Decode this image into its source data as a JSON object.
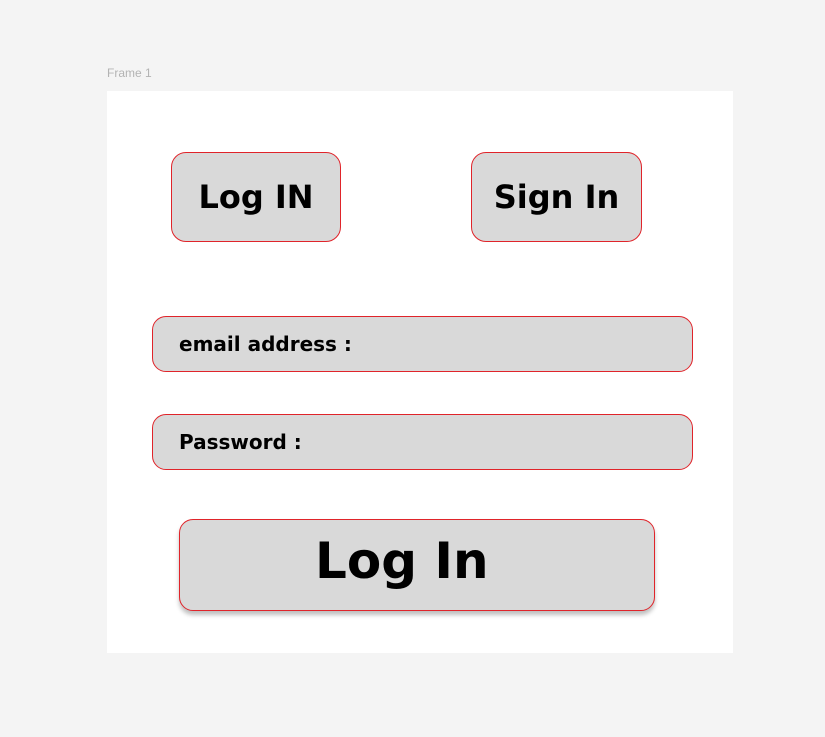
{
  "canvas": {
    "frame_label": "Frame 1"
  },
  "tabs": {
    "login_label": "Log IN",
    "signin_label": "Sign In"
  },
  "form": {
    "email_label": "email address :",
    "password_label": "Password :",
    "submit_label": "Log In"
  },
  "colors": {
    "canvas_background": "#f4f4f4",
    "frame_background": "#ffffff",
    "control_fill": "#d9d9d9",
    "control_border": "#e0242a",
    "text": "#000000"
  }
}
